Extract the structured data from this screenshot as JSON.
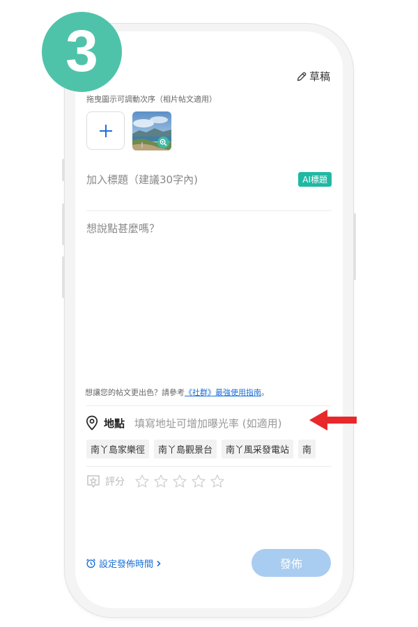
{
  "step_badge": "3",
  "header": {
    "draft_label": "草稿"
  },
  "photos": {
    "hint": "拖曳圖示可調動次序（相片帖文適用）",
    "add_icon": "plus-icon"
  },
  "post_title": {
    "placeholder": "加入標題（建議30字內)",
    "ai_button_label": "AI標題"
  },
  "post_content": {
    "placeholder": "想說點甚麼嗎？"
  },
  "guide": {
    "prefix": "想讓您的帖文更出色？請參考",
    "link": "《社群》最強使用指南",
    "suffix": "。"
  },
  "location": {
    "label": "地點",
    "placeholder": "填寫地址可增加曝光率 (如適用)",
    "icon": "location-pin-icon"
  },
  "suggested_locations": [
    "南丫島家樂徑",
    "南丫島觀景台",
    "南丫風采發電站",
    "南"
  ],
  "rating": {
    "label": "評分",
    "stars_total": 5,
    "value": 0
  },
  "schedule": {
    "label": "設定發佈時間",
    "icon": "alarm-clock-icon"
  },
  "publish_button": {
    "label": "發佈"
  },
  "colors": {
    "accent_teal": "#4fc3a9",
    "link_blue": "#1a6fd6",
    "publish_disabled": "#a9cdf0",
    "arrow_red": "#e8282b"
  }
}
